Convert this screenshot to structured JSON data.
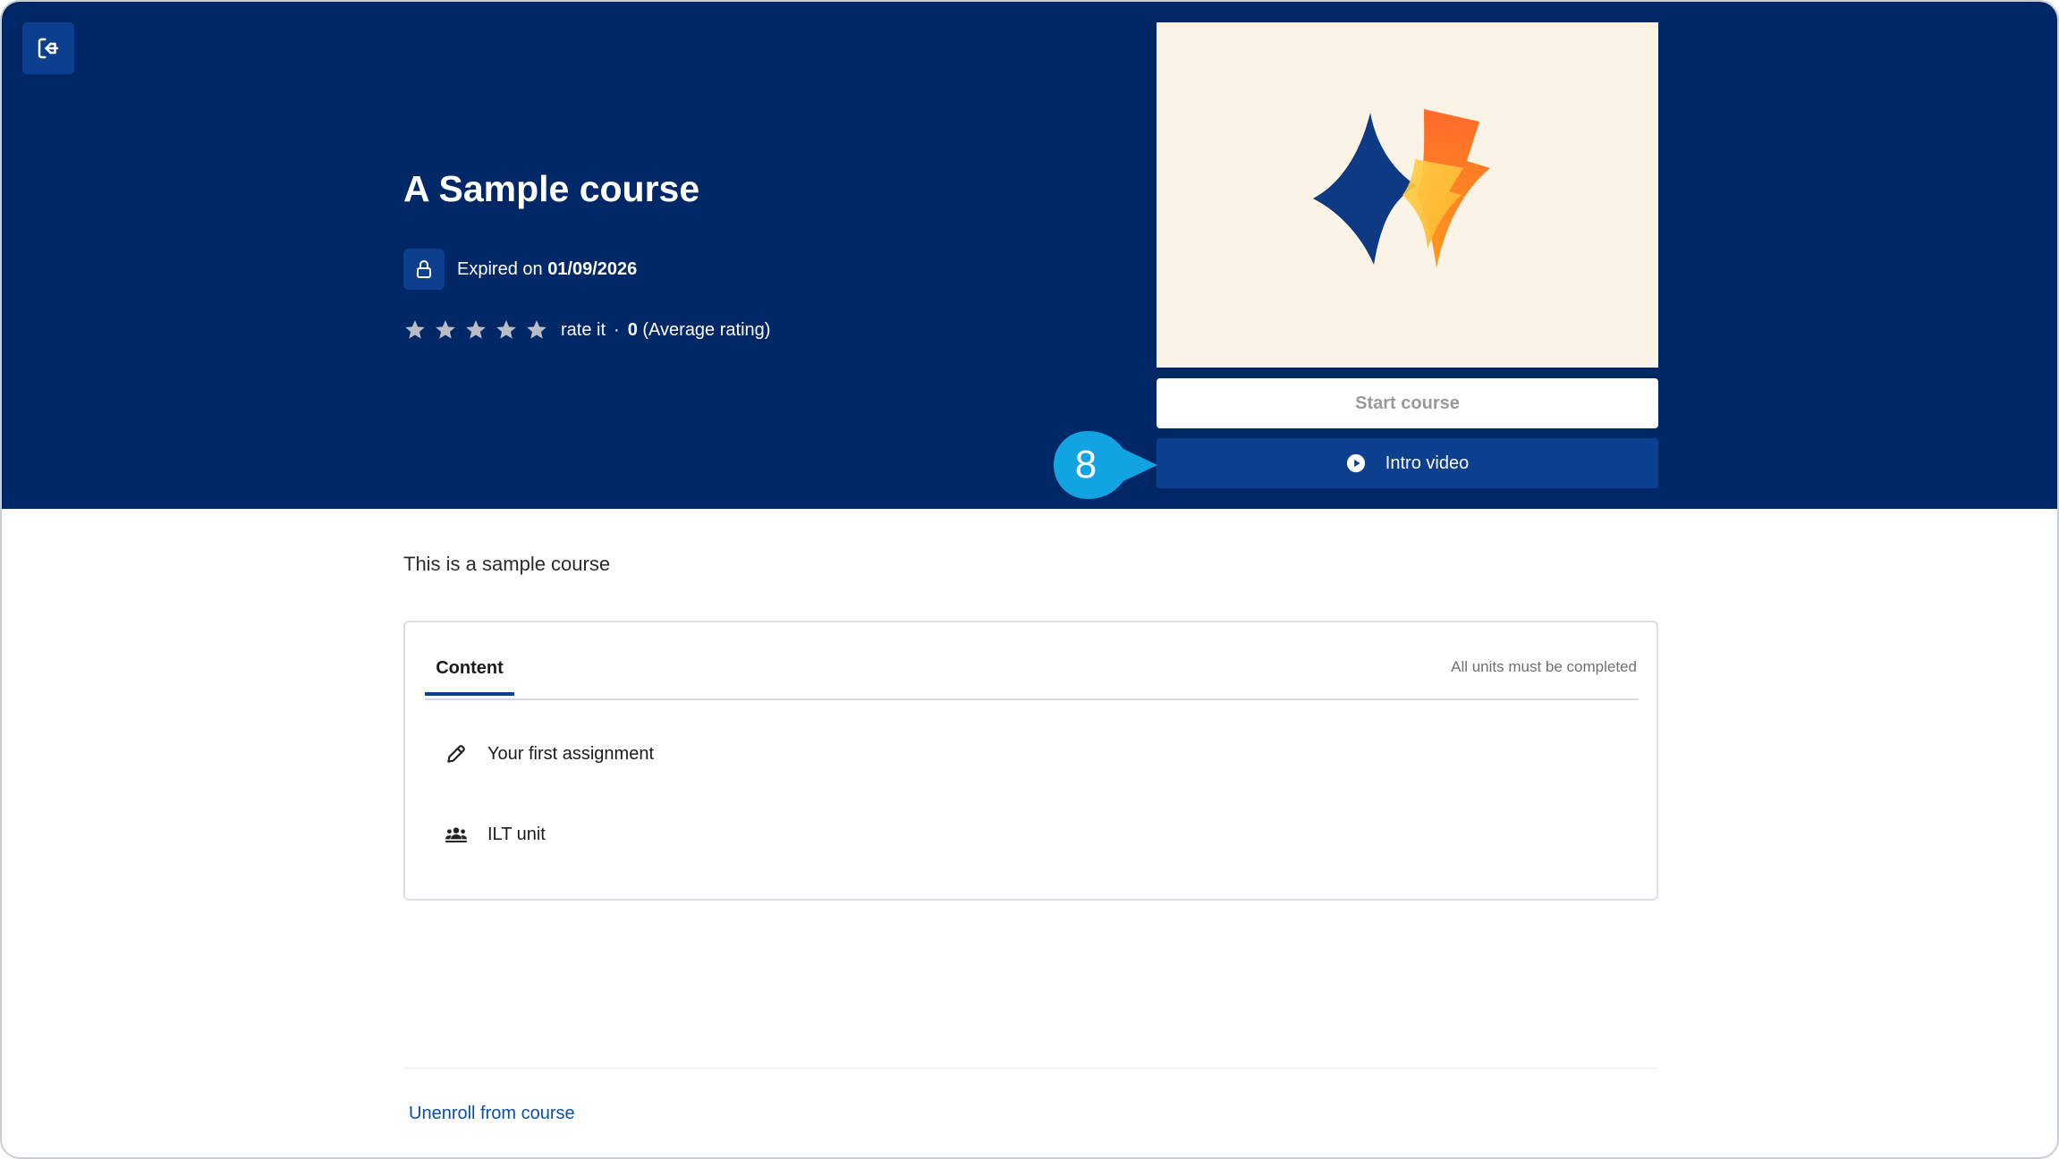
{
  "course": {
    "title": "A Sample course",
    "expiry_prefix": "Expired on",
    "expiry_date": "01/09/2026",
    "rating": {
      "stars_total": 5,
      "rate_label": "rate it",
      "separator": "·",
      "average_value": "0",
      "average_label": "(Average rating)"
    },
    "description": "This is a sample course"
  },
  "actions": {
    "start_label": "Start course",
    "intro_label": "Intro video"
  },
  "callout": {
    "number": "8"
  },
  "content_panel": {
    "tab_label": "Content",
    "completion_note": "All units must be completed",
    "units": [
      {
        "label": "Your first assignment",
        "icon": "pencil-icon"
      },
      {
        "label": "ILT unit",
        "icon": "group-icon"
      }
    ]
  },
  "footer": {
    "unenroll_label": "Unenroll from course"
  },
  "colors": {
    "hero_bg": "#012866",
    "accent": "#0d3f8f",
    "callout": "#12a3e3",
    "link": "#0d4fa8"
  }
}
